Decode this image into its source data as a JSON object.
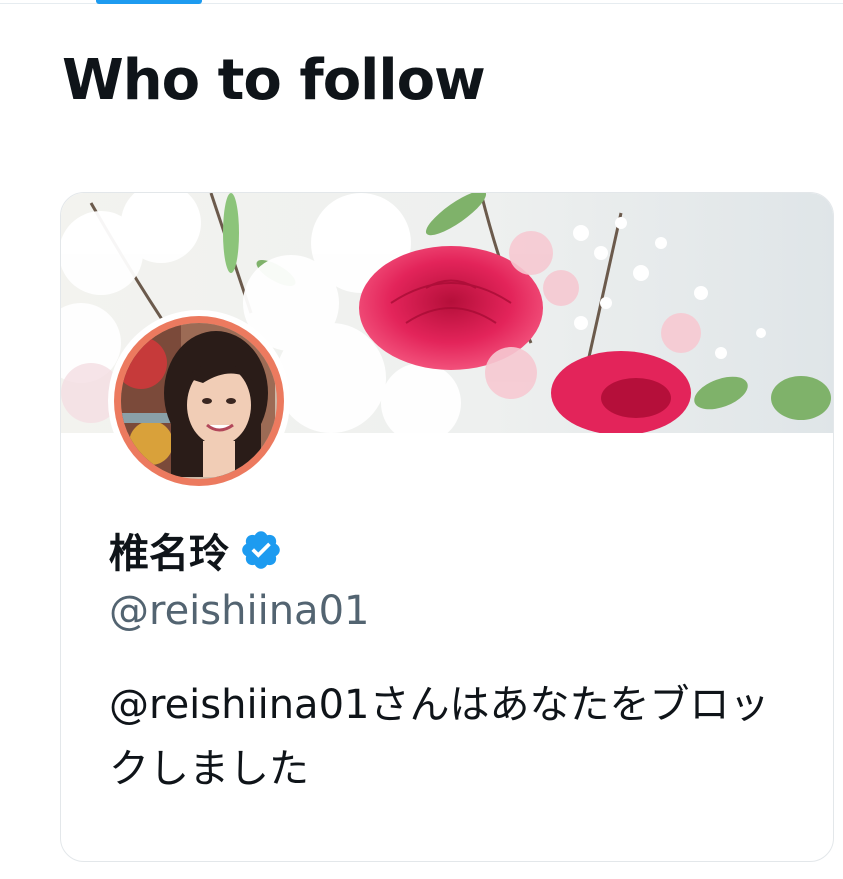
{
  "section": {
    "title": "Who to follow"
  },
  "profile": {
    "display_name": "椎名玲",
    "verified": true,
    "handle": "@reishiina01",
    "blocked_message": "@reishiina01さんはあなたをブロックしました"
  },
  "colors": {
    "accent": "#1d9bf0",
    "avatar_ring": "#ec7a5f",
    "handle_text": "#536471",
    "primary_text": "#0f1419"
  },
  "icons": {
    "verified": "verified-badge-icon"
  }
}
